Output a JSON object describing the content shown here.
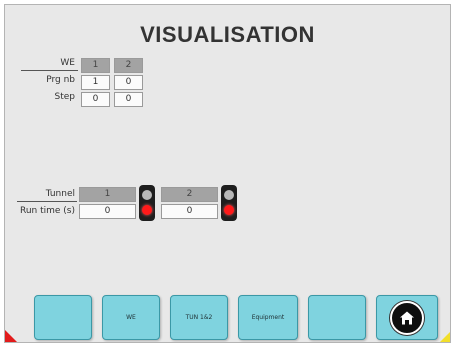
{
  "title": "VISUALISATION",
  "we_table": {
    "row_labels": {
      "we": "WE",
      "prg_nb": "Prg nb",
      "step": "Step"
    },
    "columns": [
      {
        "header": "1",
        "prg_nb": "1",
        "step": "0"
      },
      {
        "header": "2",
        "prg_nb": "0",
        "step": "0"
      }
    ]
  },
  "tunnel_table": {
    "row_labels": {
      "tunnel": "Tunnel",
      "run_time": "Run time (s)"
    },
    "tunnels": [
      {
        "number": "1",
        "run_time": "0",
        "light": "red"
      },
      {
        "number": "2",
        "run_time": "0",
        "light": "red"
      }
    ]
  },
  "nav": {
    "buttons": [
      {
        "label": ""
      },
      {
        "label": "WE"
      },
      {
        "label": "TUN 1&2"
      },
      {
        "label": "Equipment"
      },
      {
        "label": ""
      }
    ],
    "home_icon": "home-icon"
  },
  "colors": {
    "button_fill": "#7fd3df",
    "header_cell": "#a3a3a3",
    "light_on": "#ff1a1a",
    "corner_left": "#e21b1b",
    "corner_right": "#f2df2a"
  }
}
